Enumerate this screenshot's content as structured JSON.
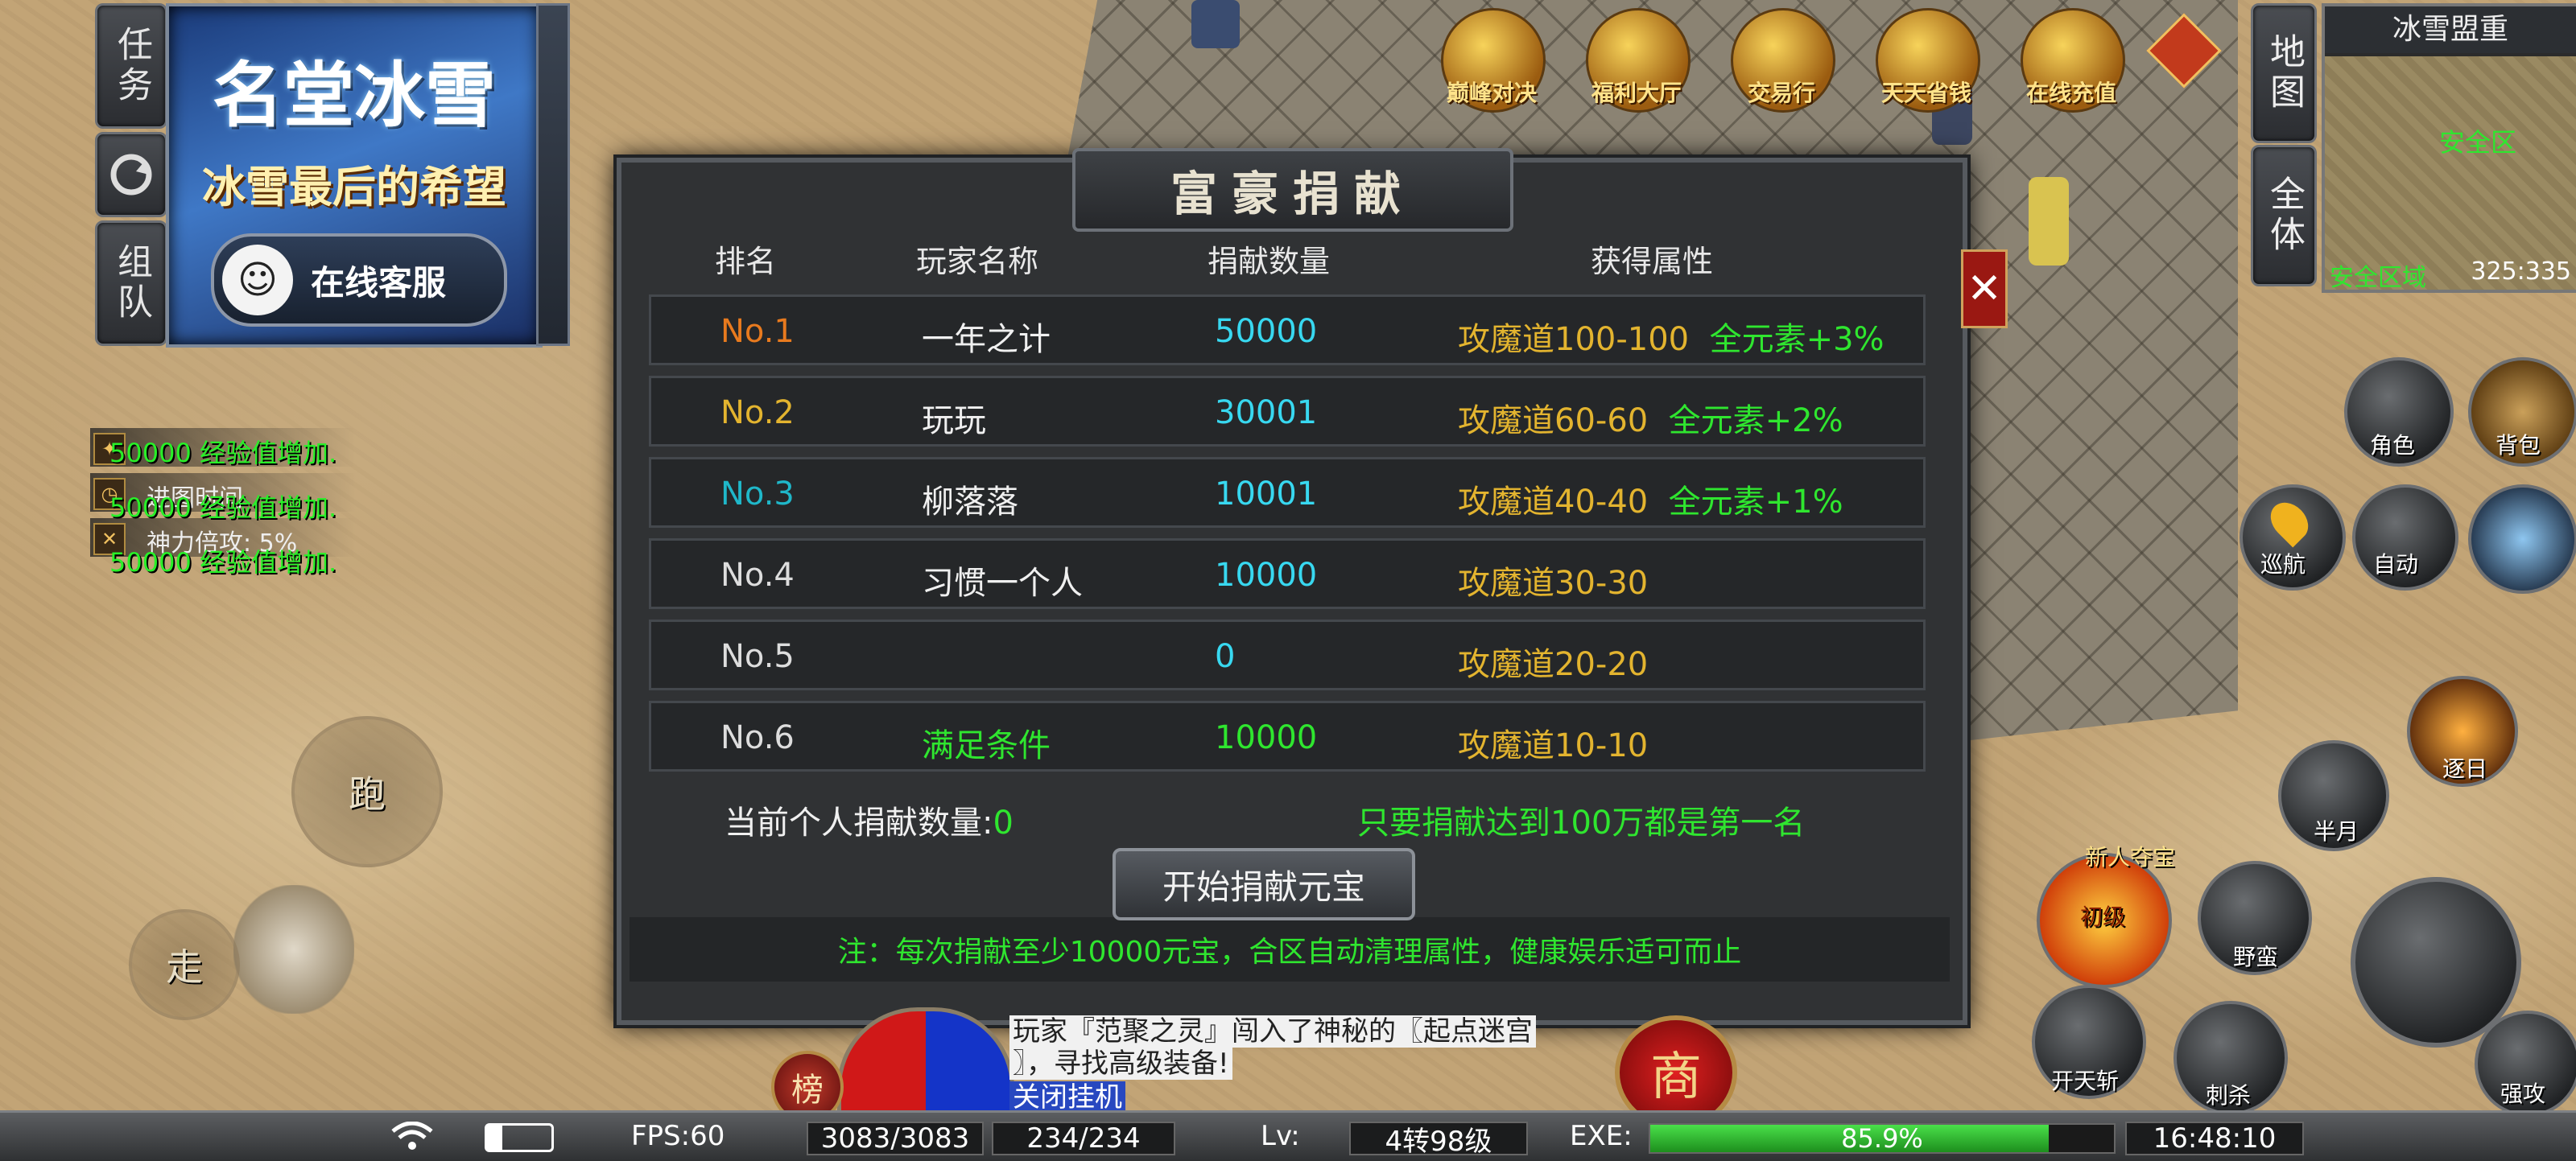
{
  "left_panel": {
    "task_tab": "任务",
    "refresh_icon": "refresh-icon",
    "team_tab": "组队"
  },
  "banner": {
    "title": "名堂冰雪",
    "subtitle": "冰雪最后的希望",
    "service_label": "在线客服"
  },
  "buffs": [
    {
      "icon": "exp-buff-icon",
      "text": ""
    },
    {
      "icon": "clock-icon",
      "text": "进图时间"
    },
    {
      "icon": "power-icon",
      "text": "神力倍攻: 5%"
    }
  ],
  "exp_messages": [
    "50000 经验值增加.",
    "50000 经验值增加.",
    "50000 经验值增加."
  ],
  "controls": {
    "run_label": "跑",
    "walk_label": "走"
  },
  "modal": {
    "title": "富豪捐献",
    "headers": {
      "rank": "排名",
      "name": "玩家名称",
      "amount": "捐献数量",
      "attr": "获得属性"
    },
    "rows": [
      {
        "rank": "No.1",
        "rank_color": "#e87a1e",
        "name": "一年之计",
        "amount": "50000",
        "attr_a": "攻魔道",
        "attr_b": "100-100",
        "attr_c": "全元素+3%"
      },
      {
        "rank": "No.2",
        "rank_color": "#e3b42f",
        "name": "玩玩",
        "amount": "30001",
        "attr_a": "攻魔道",
        "attr_b": "60-60",
        "attr_c": "全元素+2%"
      },
      {
        "rank": "No.3",
        "rank_color": "#1fb7c9",
        "name": "柳落落",
        "amount": "10001",
        "attr_a": "攻魔道",
        "attr_b": "40-40",
        "attr_c": "全元素+1%"
      },
      {
        "rank": "No.4",
        "rank_color": "#dddddd",
        "name": "习惯一个人",
        "amount": "10000",
        "attr_a": "攻魔道",
        "attr_b": "30-30",
        "attr_c": ""
      },
      {
        "rank": "No.5",
        "rank_color": "#dddddd",
        "name": "",
        "amount": "0",
        "attr_a": "攻魔道",
        "attr_b": "20-20",
        "attr_c": ""
      },
      {
        "rank": "No.6",
        "rank_color": "#dddddd",
        "name": "满足条件",
        "amount": "10000",
        "attr_a": "攻魔道",
        "attr_b": "10-10",
        "attr_c": ""
      }
    ],
    "personal_label": "当前个人捐献数量:",
    "personal_value": "0",
    "goal_text": "只要捐献达到100万都是第一名",
    "donate_button": "开始捐献元宝",
    "note": "注：每次捐献至少10000元宝，合区自动清理属性，健康娱乐适可而止",
    "close_icon": "close-icon"
  },
  "activities": [
    "巅峰对决",
    "福利大厅",
    "交易行",
    "天天省钱",
    "在线充值"
  ],
  "minimap": {
    "map_tab": "地图",
    "all_tab": "全体",
    "title": "冰雪盟重",
    "safe_label": "安全区",
    "zone_label": "安全区域",
    "coords": "325:335"
  },
  "right_buttons": {
    "character": "角色",
    "bag": "背包",
    "navigate": "巡航",
    "auto": "自动"
  },
  "skills": [
    "逐日",
    "半月",
    "新人夺宝",
    "初级",
    "野蛮",
    "开天斩",
    "刺杀",
    "强攻"
  ],
  "chat": {
    "line1": "玩家『范聚之灵』闯入了神秘的〖起点迷宫",
    "line2": "〗，寻找高级装备!",
    "close_hangup": "关闭挂机"
  },
  "hud": {
    "rank_badge": "榜",
    "shop_badge": "商",
    "fps": "FPS:60",
    "hp": "3083/3083",
    "mp": "234/234",
    "lv_label": "Lv:",
    "level": "4转98级",
    "exe_label": "EXE:",
    "exp_percent": 85.9,
    "exp_text": "85.9%",
    "time": "16:48:10"
  }
}
